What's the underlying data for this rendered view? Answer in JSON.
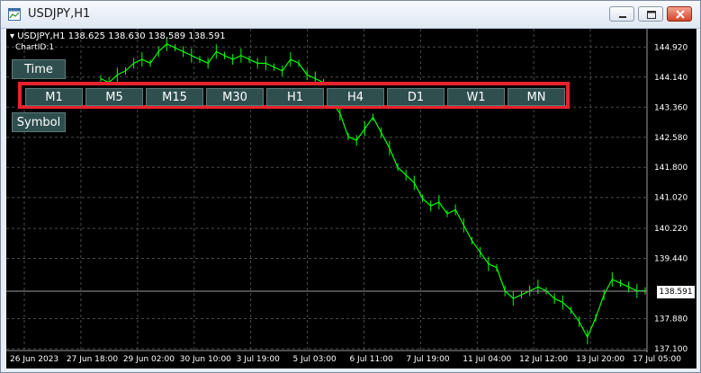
{
  "window": {
    "title": "USDJPY,H1",
    "icons": {
      "app": "chart-window-icon",
      "minimize": "minimize-icon",
      "maximize": "maximize-icon",
      "close": "close-icon"
    }
  },
  "chart": {
    "symbol_line": "USDJPY,H1  138.625 138.630 138.589 138.591",
    "chart_id": "ChartID:1",
    "current_price": "138.591",
    "side_buttons": {
      "time": "Time",
      "symbol": "Symbol"
    },
    "timeframes": [
      "M1",
      "M5",
      "M15",
      "M30",
      "H1",
      "H4",
      "D1",
      "W1",
      "MN"
    ],
    "colors": {
      "background": "#000000",
      "candles": "#00ff00",
      "grid": "#4a4a4a",
      "panel_border": "#e8232b",
      "button_bg": "#2f4f4f",
      "text": "#ffffff"
    }
  },
  "chart_data": {
    "type": "line",
    "title": "USDJPY,H1",
    "xlabel": "",
    "ylabel": "",
    "ylim": [
      137.1,
      145.3
    ],
    "grid": true,
    "y_ticks": [
      "144.920",
      "144.140",
      "143.360",
      "142.580",
      "141.800",
      "141.020",
      "140.220",
      "139.440",
      "137.880",
      "137.100"
    ],
    "x_ticks": [
      "26 Jun 2023",
      "27 Jun 18:00",
      "29 Jun 02:00",
      "30 Jun 10:00",
      "3 Jul 19:00",
      "5 Jul 03:00",
      "6 Jul 11:00",
      "7 Jul 19:00",
      "11 Jul 04:00",
      "12 Jul 12:00",
      "13 Jul 20:00",
      "17 Jul 05:00"
    ],
    "series": [
      {
        "values": [
          144.1,
          144.0,
          144.2,
          144.3,
          144.5,
          144.6,
          144.5,
          144.8,
          145.0,
          144.9,
          144.8,
          144.7,
          144.6,
          144.5,
          144.8,
          144.7,
          144.6,
          144.7,
          144.6,
          144.5,
          144.5,
          144.4,
          144.3,
          144.6,
          144.5,
          144.2,
          144.1,
          144.0,
          143.5,
          143.2,
          142.6,
          142.5,
          142.8,
          143.1,
          142.7,
          142.3,
          141.8,
          141.6,
          141.4,
          141.0,
          140.8,
          140.9,
          140.6,
          140.7,
          140.3,
          139.9,
          139.6,
          139.3,
          139.2,
          138.6,
          138.4,
          138.5,
          138.6,
          138.7,
          138.6,
          138.4,
          138.3,
          138.1,
          137.8,
          137.4,
          137.9,
          138.5,
          138.9,
          138.8,
          138.7,
          138.6,
          138.6
        ]
      }
    ]
  }
}
